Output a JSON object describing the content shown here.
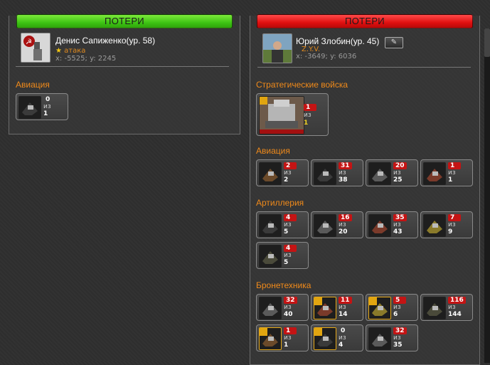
{
  "left": {
    "header": "ПОТЕРИ",
    "player": {
      "name": "Денис Сапиженко(ур. 58)",
      "role": "атака",
      "coords": "x: -5525; y: 2245"
    },
    "sections": [
      {
        "title": "Авиация",
        "units": [
          {
            "lost": "0",
            "of": "из",
            "total": "1",
            "gold": false
          }
        ]
      }
    ]
  },
  "right": {
    "header": "ПОТЕРИ",
    "player": {
      "name": "Юрий Злобин(ур. 45)",
      "role": "Z.Y.V.",
      "coords": "x: -3649; y: 6036"
    },
    "strategic": {
      "title": "Стратегические войска",
      "lost": "1",
      "of": "из",
      "total": "1"
    },
    "sections": [
      {
        "title": "Авиация",
        "units": [
          {
            "lost": "2",
            "of": "из",
            "total": "2",
            "gold": false
          },
          {
            "lost": "31",
            "of": "из",
            "total": "38",
            "gold": false
          },
          {
            "lost": "20",
            "of": "из",
            "total": "25",
            "gold": false
          },
          {
            "lost": "1",
            "of": "из",
            "total": "1",
            "gold": false
          }
        ]
      },
      {
        "title": "Артиллерия",
        "units": [
          {
            "lost": "4",
            "of": "из",
            "total": "5",
            "gold": false
          },
          {
            "lost": "16",
            "of": "из",
            "total": "20",
            "gold": false
          },
          {
            "lost": "35",
            "of": "из",
            "total": "43",
            "gold": false
          },
          {
            "lost": "7",
            "of": "из",
            "total": "9",
            "gold": false
          },
          {
            "lost": "4",
            "of": "из",
            "total": "5",
            "gold": false
          }
        ]
      },
      {
        "title": "Бронетехника",
        "units": [
          {
            "lost": "32",
            "of": "из",
            "total": "40",
            "gold": false
          },
          {
            "lost": "11",
            "of": "из",
            "total": "14",
            "gold": true
          },
          {
            "lost": "5",
            "of": "из",
            "total": "6",
            "gold": true
          },
          {
            "lost": "116",
            "of": "из",
            "total": "144",
            "gold": false
          },
          {
            "lost": "1",
            "of": "из",
            "total": "1",
            "gold": true
          },
          {
            "lost": "0",
            "of": "из",
            "total": "4",
            "gold": true
          },
          {
            "lost": "32",
            "of": "из",
            "total": "35",
            "gold": false
          }
        ]
      }
    ]
  },
  "colors": {
    "attacker_header": "#3ec414",
    "defender_header": "#e01010",
    "section_title": "#f08a1a",
    "loss_badge": "#c41414"
  }
}
